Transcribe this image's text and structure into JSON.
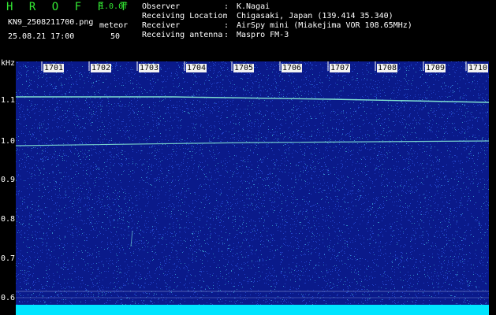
{
  "header": {
    "app_title": "H R O F F T",
    "version": "1.0.0f",
    "filename": "KN9_2508211700.png",
    "mode": "meteor",
    "datetime": "25.08.21 17:00",
    "count": "50"
  },
  "info": [
    {
      "key": "Observer",
      "value": "K.Nagai"
    },
    {
      "key": "Receiving Location",
      "value": "Chigasaki, Japan (139.414 35.340)"
    },
    {
      "key": "Receiver",
      "value": "AirSpy mini (Miakejima VOR 108.65MHz)"
    },
    {
      "key": "Receiving antenna",
      "value": "Maspro FM-3"
    }
  ],
  "plot": {
    "y_unit": "kHz",
    "y_labels": [
      "1.1",
      "1.0",
      "0.9",
      "0.8",
      "0.7",
      "0.6"
    ],
    "minute_labels": [
      "1701",
      "1702",
      "1703",
      "1704",
      "1705",
      "1706",
      "1707",
      "1708",
      "1709",
      "1710"
    ],
    "background_color": "#0a1a8a",
    "trace_color": "#7fe0d0"
  }
}
